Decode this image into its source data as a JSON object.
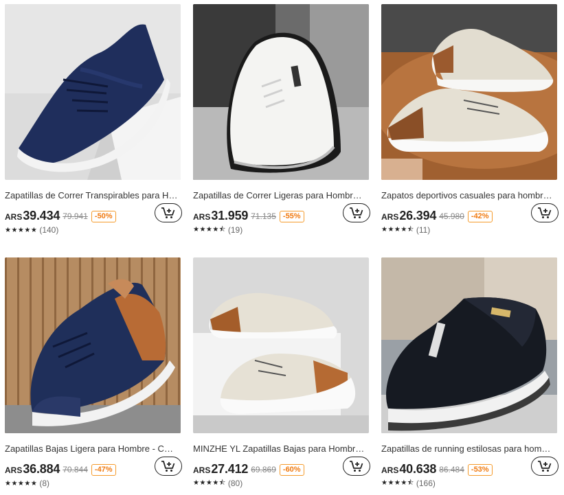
{
  "colors": {
    "discount": "#f07a10",
    "text": "#222222",
    "muted": "#888888"
  },
  "products": [
    {
      "title": "Zapatillas de Correr Transpirables para Ho...",
      "currency": "ARS",
      "price": "39.434",
      "original_price": "79.941",
      "discount": "-50%",
      "stars": "★★★★★",
      "reviews": "(140)",
      "image": "navy-knit-running-shoe"
    },
    {
      "title": "Zapatillas de Correr Ligeras para Hombre -...",
      "currency": "ARS",
      "price": "31.959",
      "original_price": "71.135",
      "discount": "-55%",
      "stars": "★★★★⯪",
      "reviews": "(19)",
      "image": "white-leather-sneakers"
    },
    {
      "title": "Zapatos deportivos casuales para hombre, ...",
      "currency": "ARS",
      "price": "26.394",
      "original_price": "45.980",
      "discount": "-42%",
      "stars": "★★★★⯪",
      "reviews": "(11)",
      "image": "beige-brown-sneakers"
    },
    {
      "title": "Zapatillas Bajas Ligera para Hombre - Calz...",
      "currency": "ARS",
      "price": "36.884",
      "original_price": "70.844",
      "discount": "-47%",
      "stars": "★★★★★",
      "reviews": "(8)",
      "image": "navy-brown-sneaker"
    },
    {
      "title": "MINZHE YL Zapatillas Bajas para Hombre -...",
      "currency": "ARS",
      "price": "27.412",
      "original_price": "69.869",
      "discount": "-60%",
      "stars": "★★★★⯪",
      "reviews": "(80)",
      "image": "beige-brown-sneakers-pair"
    },
    {
      "title": "Zapatillas de running estilosas para hombr...",
      "currency": "ARS",
      "price": "40.638",
      "original_price": "86.484",
      "discount": "-53%",
      "stars": "★★★★⯪",
      "reviews": "(166)",
      "image": "black-slip-on-shoe"
    }
  ]
}
